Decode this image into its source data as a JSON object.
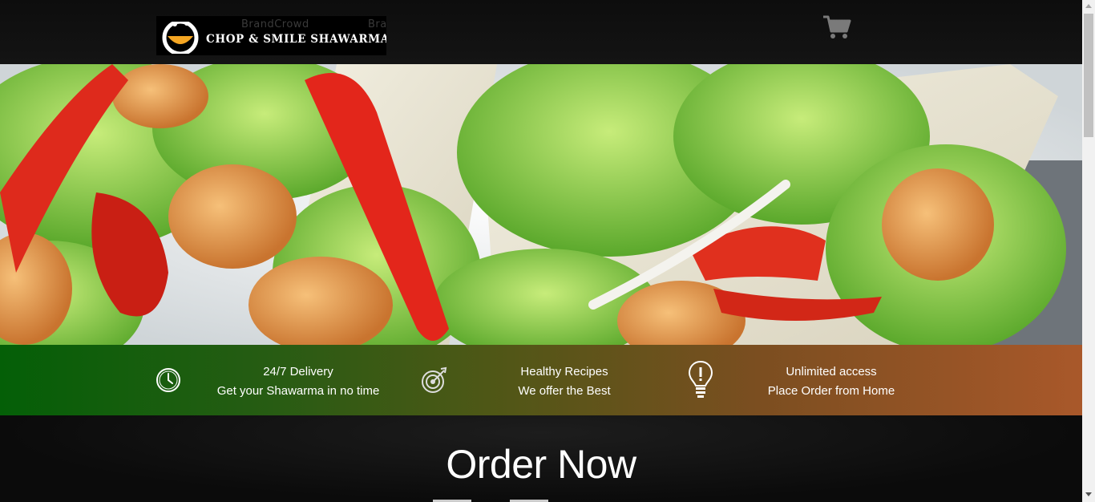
{
  "header": {
    "logo": {
      "brand_name": "CHOP & SMILE SHAWARMA",
      "watermark_1": "BrandCrowd",
      "watermark_2": "Brand"
    },
    "cart_icon": "shopping-cart-icon"
  },
  "hero": {
    "image": "shawarma wraps with lettuce, tomato and fried chicken"
  },
  "features": [
    {
      "icon": "clock-icon",
      "title": "24/7 Delivery",
      "subtitle": "Get your Shawarma in no time"
    },
    {
      "icon": "target-icon",
      "title": "Healthy Recipes",
      "subtitle": "We offer the Best"
    },
    {
      "icon": "lightbulb-icon",
      "title": "Unlimited access",
      "subtitle": "Place Order from Home"
    }
  ],
  "order": {
    "heading": "Order Now"
  },
  "colors": {
    "features_start": "#045f07",
    "features_end": "#a9582a",
    "logo_orange": "#f5a623",
    "header_bg": "#0d0d0d"
  }
}
